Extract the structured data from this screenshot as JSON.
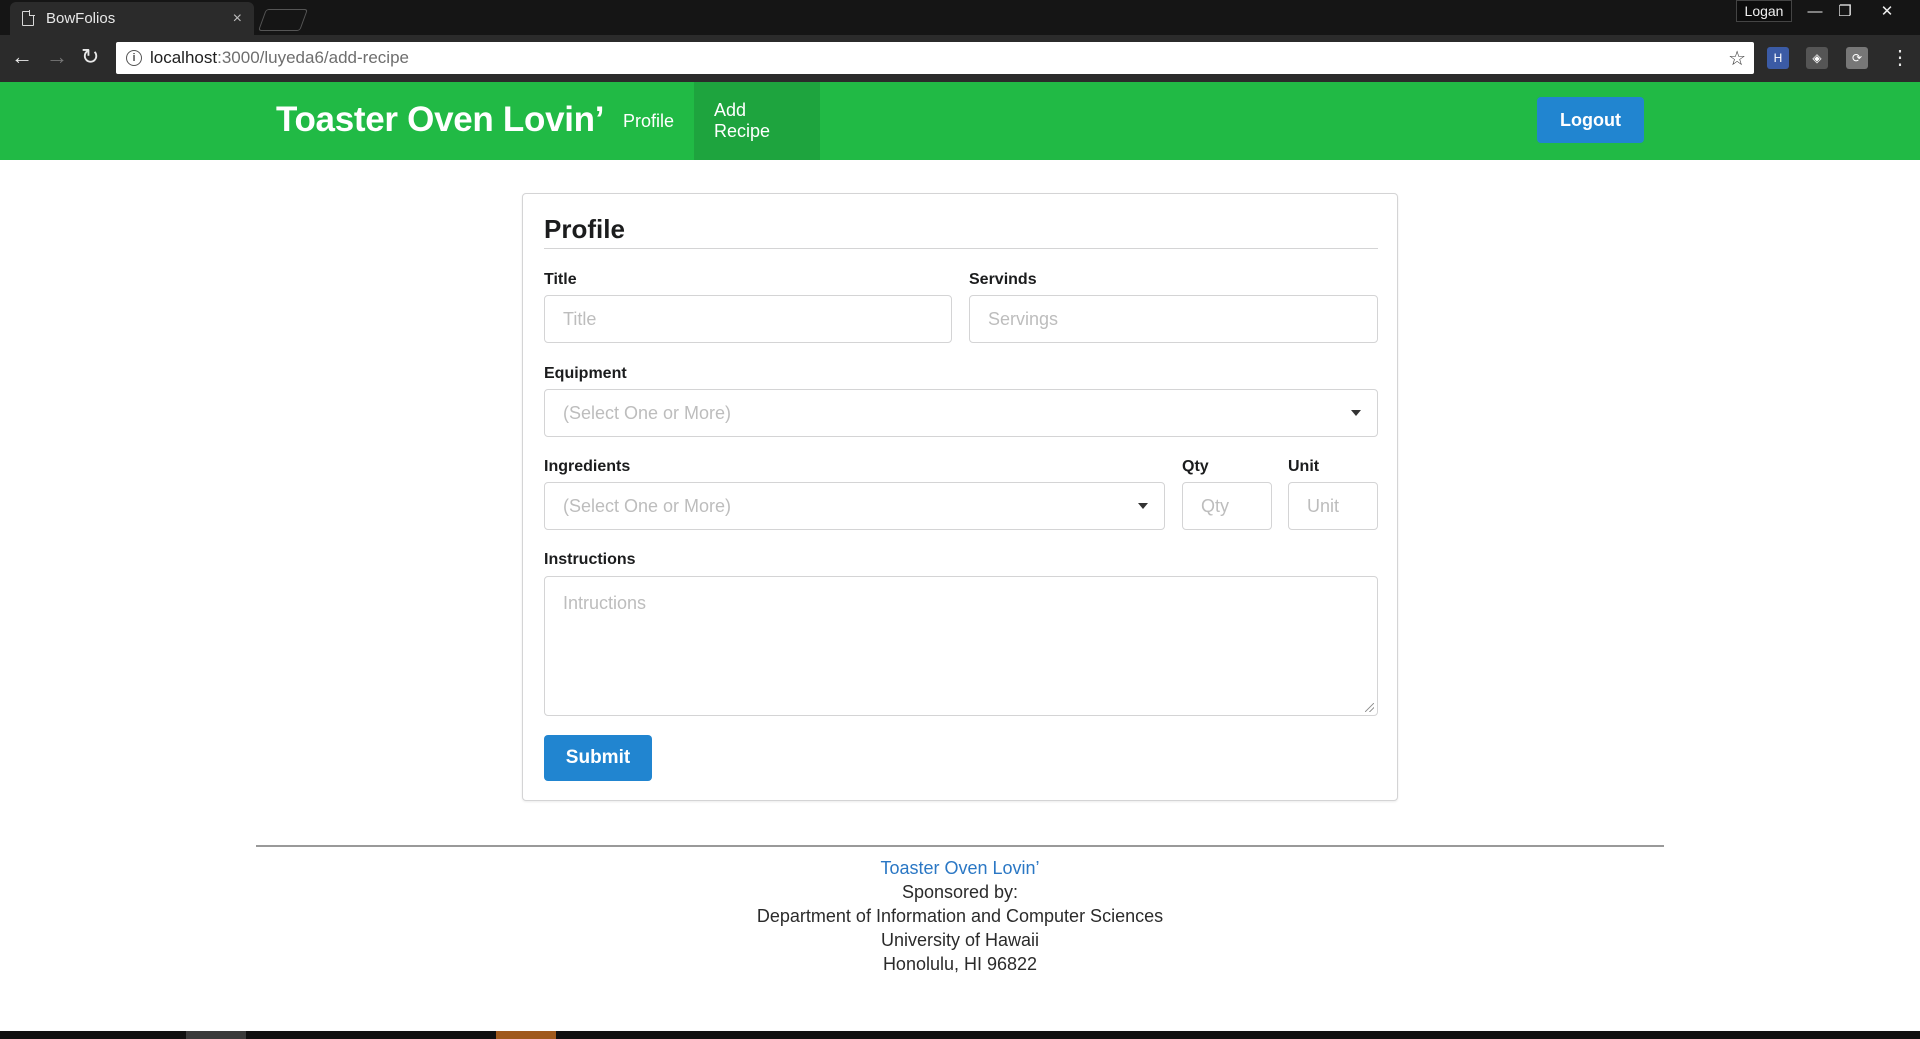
{
  "browser": {
    "tab_title": "BowFolios",
    "tab_close": "×",
    "profile_name": "Logan",
    "window_controls": [
      "—",
      "❐",
      "✕"
    ],
    "url_host": "localhost",
    "url_path": ":3000/luyeda6/add-recipe",
    "back": "←",
    "forward": "→",
    "reload": "↻",
    "bookmark": "☆",
    "menu": "⋮",
    "extensions": [
      {
        "name": "h-extension-icon",
        "glyph": "H",
        "color": "#3b5ba5"
      },
      {
        "name": "shield-extension-icon",
        "glyph": "◈",
        "color": "#555555"
      },
      {
        "name": "refresh-extension-icon",
        "glyph": "⟳",
        "color": "#777777"
      }
    ]
  },
  "navbar": {
    "brand": "Toaster Oven Lovin’",
    "items": [
      {
        "label": "Profile",
        "active": false
      },
      {
        "label": "Add Recipe",
        "active": true
      }
    ],
    "logout": "Logout"
  },
  "form": {
    "title": "Profile",
    "title_field": {
      "label": "Title",
      "placeholder": "Title"
    },
    "servings_field": {
      "label": "Servinds",
      "placeholder": "Servings"
    },
    "equipment_field": {
      "label": "Equipment",
      "placeholder": "(Select One or More)"
    },
    "ingredients_field": {
      "label": "Ingredients",
      "placeholder": "(Select One or More)"
    },
    "qty_field": {
      "label": "Qty",
      "placeholder": "Qty"
    },
    "unit_field": {
      "label": "Unit",
      "placeholder": "Unit"
    },
    "instructions_field": {
      "label": "Instructions",
      "placeholder": "Intructions"
    },
    "submit": "Submit"
  },
  "footer": {
    "link": "Toaster Oven Lovin’",
    "lines": [
      "Sponsored by:",
      "Department of Information and Computer Sciences",
      "University of Hawaii",
      "Honolulu, HI 96822"
    ]
  },
  "colors": {
    "navbar": "#21ba45",
    "navbar_active": "#1ea43e",
    "primary_button": "#2185d0",
    "footer_link": "#2a77c4"
  }
}
